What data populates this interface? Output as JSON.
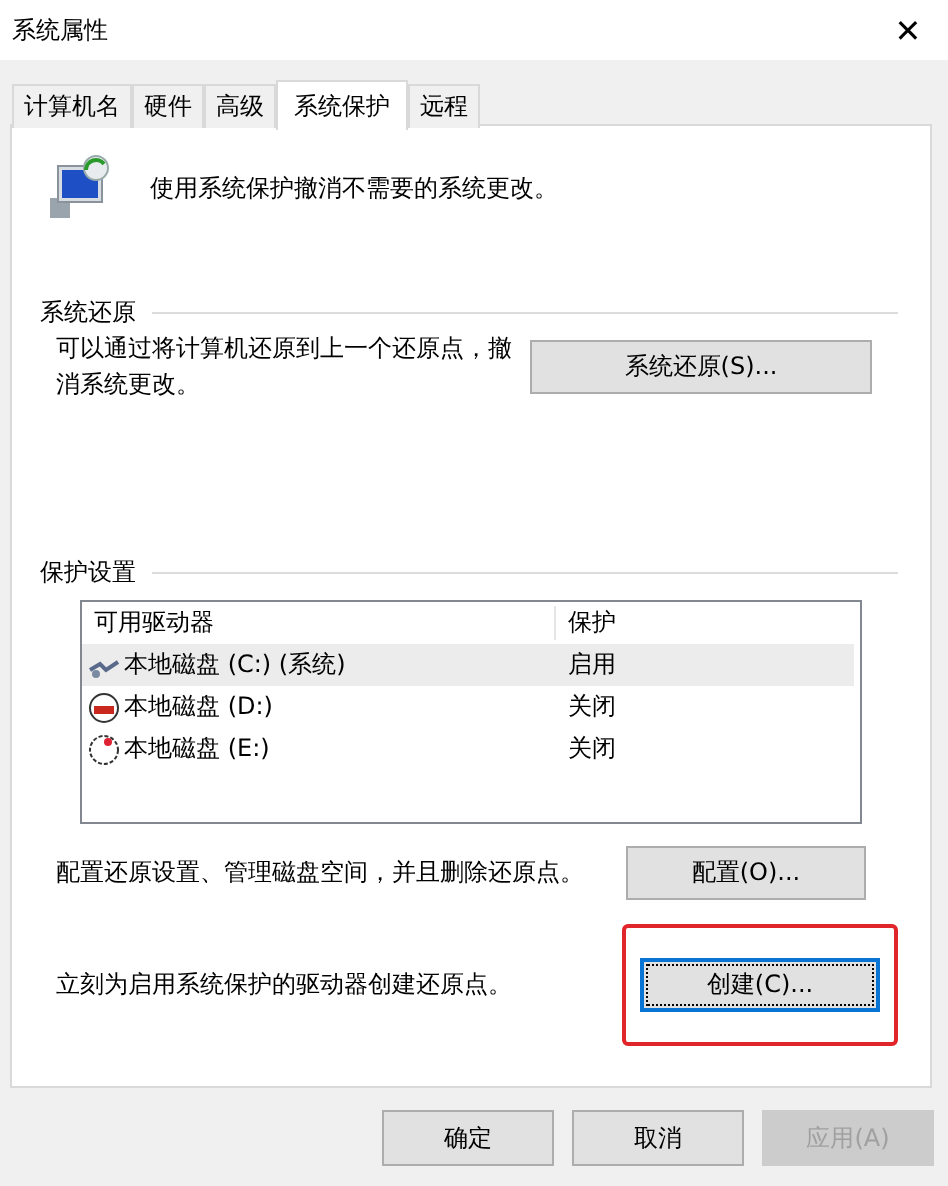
{
  "window": {
    "title": "系统属性",
    "close": "✕"
  },
  "tabs": [
    {
      "label": "计算机名",
      "selected": false
    },
    {
      "label": "硬件",
      "selected": false
    },
    {
      "label": "高级",
      "selected": false
    },
    {
      "label": "系统保护",
      "selected": true
    },
    {
      "label": "远程",
      "selected": false
    }
  ],
  "intro": "使用系统保护撤消不需要的系统更改。",
  "restore": {
    "heading": "系统还原",
    "text": "可以通过将计算机还原到上一个还原点，撤消系统更改。",
    "button": "系统还原(S)..."
  },
  "protection": {
    "heading": "保护设置",
    "columns": [
      "可用驱动器",
      "保护"
    ],
    "drives": [
      {
        "name": "本地磁盘 (C:) (系统)",
        "status": "启用",
        "selected": true,
        "kind": "system"
      },
      {
        "name": "本地磁盘 (D:)",
        "status": "关闭",
        "selected": false,
        "kind": "red"
      },
      {
        "name": "本地磁盘 (E:)",
        "status": "关闭",
        "selected": false,
        "kind": "outline"
      }
    ],
    "configure_text": "配置还原设置、管理磁盘空间，并且删除还原点。",
    "configure_button": "配置(O)...",
    "create_text": "立刻为启用系统保护的驱动器创建还原点。",
    "create_button": "创建(C)...",
    "create_focused": true,
    "create_highlighted": true
  },
  "buttons": [
    {
      "label": "确定",
      "disabled": false
    },
    {
      "label": "取消",
      "disabled": false
    },
    {
      "label": "应用(A)",
      "disabled": true
    }
  ]
}
